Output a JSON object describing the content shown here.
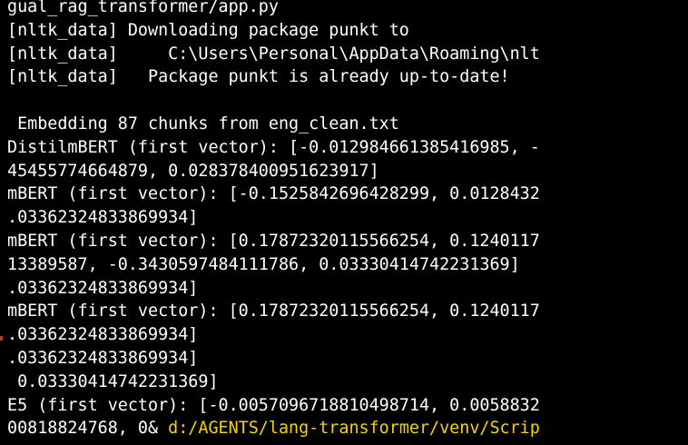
{
  "terminal": {
    "lines": [
      "gual_rag_transformer/app.py",
      "[nltk_data] Downloading package punkt to",
      "[nltk_data]     C:\\Users\\Personal\\AppData\\Roaming\\nlt",
      "[nltk_data]   Package punkt is already up-to-date!",
      "",
      " Embedding 87 chunks from eng_clean.txt",
      "DistilmBERT (first vector): [-0.012984661385416985, -",
      "45455774664879, 0.028378400951623917]",
      "mBERT (first vector): [-0.1525842696428299, 0.0128432",
      ".03362324833869934]",
      "mBERT (first vector): [0.17872320115566254, 0.1240117",
      "13389587, -0.3430597484111786, 0.03330414742231369]",
      ".03362324833869934]",
      "mBERT (first vector): [0.17872320115566254, 0.1240117",
      ".03362324833869934]",
      ".03362324833869934]",
      " 0.03330414742231369]",
      "E5 (first vector): [-0.0057096718810498714, 0.0058832"
    ],
    "prompt_prefix": "00818824768, 0& ",
    "prompt_path": "d:/AGENTS/lang-transformer/venv/Scrip",
    "colors": {
      "background": "#000000",
      "text": "#ffffff",
      "path": "#f5d300"
    }
  }
}
